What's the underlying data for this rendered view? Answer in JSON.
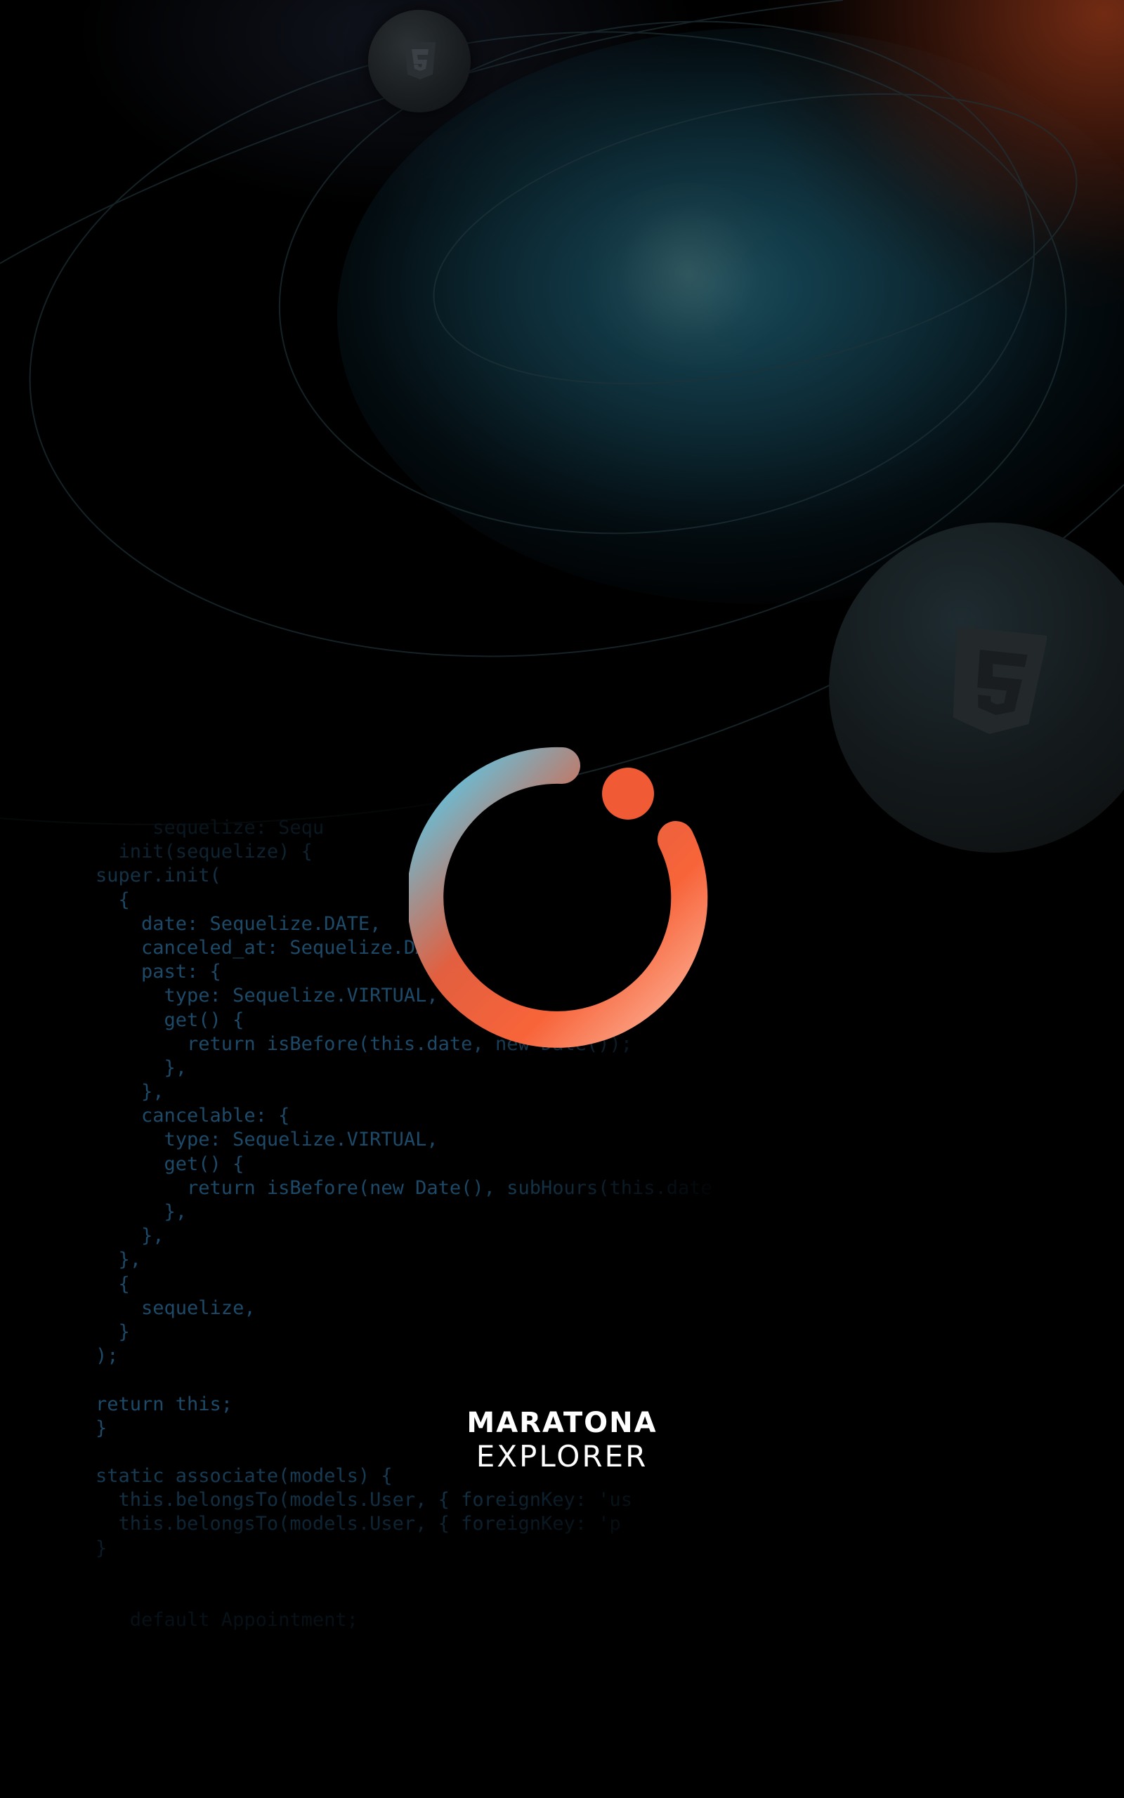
{
  "app": {
    "name_line1": "MARATONA",
    "name_line2": "EXPLORER"
  },
  "loading_indicator": {
    "state": "loading",
    "gradient_colors": [
      "#4fd1f5",
      "#e25f3f",
      "#f8643a",
      "#fbb49a"
    ],
    "dot_color": "#f05a34"
  },
  "background": {
    "icons": [
      "css3-icon",
      "html5-icon"
    ],
    "code_lines": [
      "     sequelize: Sequ",
      "  init(sequelize) {",
      "super.init(",
      "  {",
      "    date: Sequelize.DATE,",
      "    canceled_at: Sequelize.DATE,",
      "    past: {",
      "      type: Sequelize.VIRTUAL,",
      "      get() {",
      "        return isBefore(this.date, new Date());",
      "      },",
      "    },",
      "    cancelable: {",
      "      type: Sequelize.VIRTUAL,",
      "      get() {",
      "        return isBefore(new Date(), subHours(this.date",
      "      },",
      "    },",
      "  },",
      "  {",
      "    sequelize,",
      "  }",
      ");",
      "",
      "return this;",
      "}",
      "",
      "static associate(models) {",
      "  this.belongsTo(models.User, { foreignKey: 'us",
      "  this.belongsTo(models.User, { foreignKey: 'p",
      "}",
      "",
      "",
      "   default Appointment;"
    ],
    "colors": {
      "teal_glow": "#184e60",
      "orange_glow": "#782d14",
      "code_text": "#1d4a68"
    }
  }
}
